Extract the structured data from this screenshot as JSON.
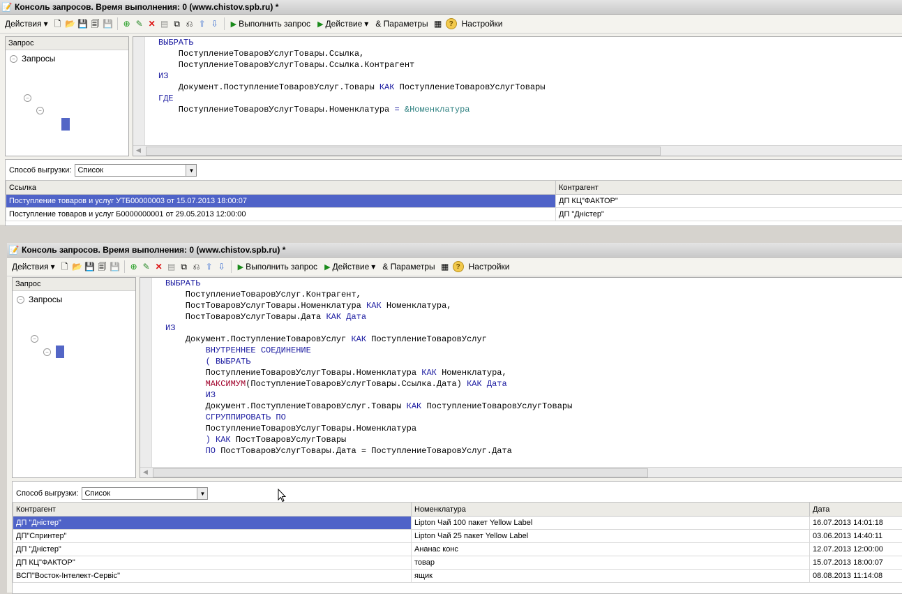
{
  "window1": {
    "title": "Консоль запросов. Время выполнения: 0 (www.chistov.spb.ru) *",
    "toolbar": {
      "actions": "Действия",
      "run": "Выполнить запрос",
      "action": "Действие",
      "params": "& Параметры",
      "settings": "Настройки"
    },
    "tree": {
      "header": "Запрос",
      "root": "Запросы"
    },
    "code": [
      [
        [
          "kw",
          "ВЫБРАТЬ"
        ]
      ],
      [
        [
          "t",
          "    ПоступлениеТоваровУслугТовары.Ссылка,"
        ]
      ],
      [
        [
          "t",
          "    ПоступлениеТоваровУслугТовары.Ссылка.Контрагент"
        ]
      ],
      [
        [
          "kw",
          "ИЗ"
        ]
      ],
      [
        [
          "t",
          "    Документ.ПоступлениеТоваровУслуг.Товары "
        ],
        [
          "kw",
          "КАК"
        ],
        [
          "t",
          " ПоступлениеТоваровУслугТовары"
        ]
      ],
      [
        [
          "kw",
          "ГДЕ"
        ]
      ],
      [
        [
          "t",
          "    ПоступлениеТоваровУслугТовары.Номенклатура "
        ],
        [
          "kw",
          "="
        ],
        [
          "t",
          " "
        ],
        [
          "param",
          "&Номенклатура"
        ]
      ]
    ],
    "export_label": "Способ выгрузки:",
    "export_value": "Список",
    "columns": [
      "Ссылка",
      "Контрагент"
    ],
    "rows": [
      [
        "Поступление товаров и услуг УТБ00000003 от 15.07.2013 18:00:07",
        "ДП КЦ\"ФАКТОР\""
      ],
      [
        "Поступление товаров и услуг Б0000000001 от 29.05.2013 12:00:00",
        "ДП \"Дністер\""
      ]
    ]
  },
  "window2": {
    "title": "Консоль запросов. Время выполнения: 0 (www.chistov.spb.ru) *",
    "toolbar": {
      "actions": "Действия",
      "run": "Выполнить запрос",
      "action": "Действие",
      "params": "& Параметры",
      "settings": "Настройки"
    },
    "tree": {
      "header": "Запрос",
      "root": "Запросы"
    },
    "code": [
      [
        [
          "kw",
          "ВЫБРАТЬ"
        ]
      ],
      [
        [
          "t",
          "    ПоступлениеТоваровУслуг.Контрагент,"
        ]
      ],
      [
        [
          "t",
          "    ПостТоваровУслугТовары.Номенклатура "
        ],
        [
          "kw",
          "КАК"
        ],
        [
          "t",
          " Номенклатура,"
        ]
      ],
      [
        [
          "t",
          "    ПостТоваровУслугТовары.Дата "
        ],
        [
          "kw",
          "КАК Дата"
        ]
      ],
      [
        [
          "kw",
          "ИЗ"
        ]
      ],
      [
        [
          "t",
          "    Документ.ПоступлениеТоваровУслуг "
        ],
        [
          "kw",
          "КАК"
        ],
        [
          "t",
          " ПоступлениеТоваровУслуг"
        ]
      ],
      [
        [
          "t",
          "        "
        ],
        [
          "kw",
          "ВНУТРЕННЕЕ СОЕДИНЕНИЕ"
        ]
      ],
      [
        [
          "t",
          "        "
        ],
        [
          "kw",
          "( ВЫБРАТЬ"
        ]
      ],
      [
        [
          "t",
          "        ПоступлениеТоваровУслугТовары.Номенклатура "
        ],
        [
          "kw",
          "КАК"
        ],
        [
          "t",
          " Номенклатура,"
        ]
      ],
      [
        [
          "t",
          "        "
        ],
        [
          "fn",
          "МАКСИМУМ"
        ],
        [
          "t",
          "(ПоступлениеТоваровУслугТовары.Ссылка.Дата) "
        ],
        [
          "kw",
          "КАК Дата"
        ]
      ],
      [
        [
          "t",
          "        "
        ],
        [
          "kw",
          "ИЗ"
        ]
      ],
      [
        [
          "t",
          "        Документ.ПоступлениеТоваровУслуг.Товары "
        ],
        [
          "kw",
          "КАК"
        ],
        [
          "t",
          " ПоступлениеТоваровУслугТовары"
        ]
      ],
      [
        [
          "t",
          "        "
        ],
        [
          "kw",
          "СГРУППИРОВАТЬ ПО"
        ]
      ],
      [
        [
          "t",
          "        ПоступлениеТоваровУслугТовары.Номенклатура"
        ]
      ],
      [
        [
          "t",
          "        "
        ],
        [
          "kw",
          ") КАК"
        ],
        [
          "t",
          " ПостТоваровУслугТовары"
        ]
      ],
      [
        [
          "t",
          "        "
        ],
        [
          "kw",
          "ПО"
        ],
        [
          "t",
          " ПостТоваровУслугТовары.Дата = ПоступлениеТоваровУслуг.Дата"
        ]
      ]
    ],
    "export_label": "Способ выгрузки:",
    "export_value": "Список",
    "columns": [
      "Контрагент",
      "Номенклатура",
      "Дата"
    ],
    "rows": [
      [
        "ДП \"Дністер\"",
        "Lipton Чай 100 пакет Yellow Label",
        "16.07.2013 14:01:18"
      ],
      [
        "ДП\"Спринтер\"",
        "Lipton Чай 25 пакет Yellow Label",
        "03.06.2013 14:40:11"
      ],
      [
        "ДП \"Дністер\"",
        "Ананас конс",
        "12.07.2013 12:00:00"
      ],
      [
        "ДП КЦ\"ФАКТОР\"",
        "товар",
        "15.07.2013 18:00:07"
      ],
      [
        "ВСП\"Восток-Інтелект-Сервіс\"",
        "ящик",
        "08.08.2013 11:14:08"
      ]
    ]
  }
}
